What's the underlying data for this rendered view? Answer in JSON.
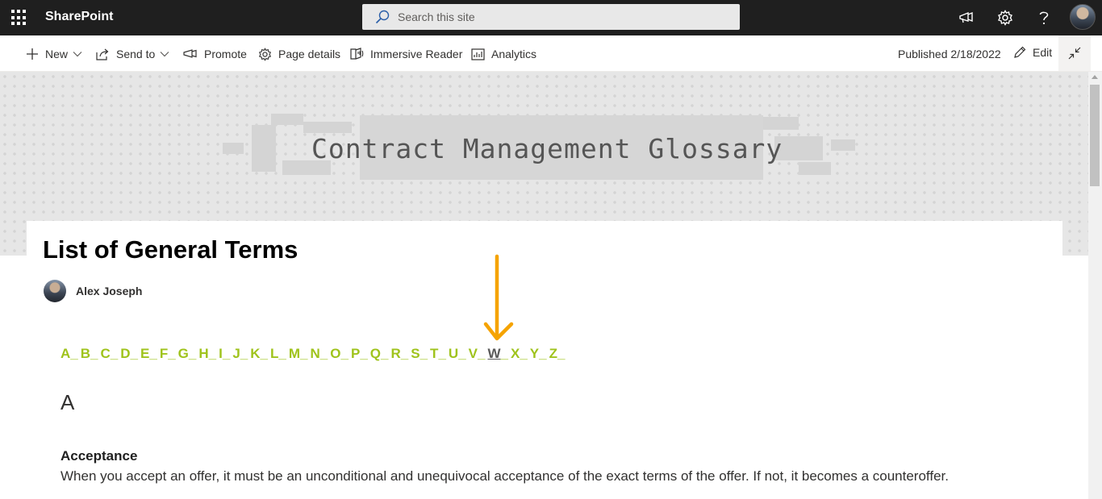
{
  "suite": {
    "app_name": "SharePoint",
    "search_placeholder": "Search this site",
    "icons": [
      "app-launcher-icon",
      "search-icon",
      "megaphone-icon",
      "gear-icon",
      "help-icon"
    ]
  },
  "commandbar": {
    "new_label": "New",
    "send_to_label": "Send to",
    "promote_label": "Promote",
    "page_details_label": "Page details",
    "immersive_reader_label": "Immersive Reader",
    "analytics_label": "Analytics",
    "published_text": "Published 2/18/2022",
    "edit_label": "Edit"
  },
  "banner": {
    "title": "Contract Management Glossary"
  },
  "page": {
    "title": "List of General Terms",
    "author": "Alex Joseph",
    "alphabet": [
      "A",
      "B",
      "C",
      "D",
      "E",
      "F",
      "G",
      "H",
      "I",
      "J",
      "K",
      "L",
      "M",
      "N",
      "O",
      "P",
      "Q",
      "R",
      "S",
      "T",
      "U",
      "V",
      "W",
      "X",
      "Y",
      "Z"
    ],
    "alphabet_separator": "_",
    "active_letter": "W",
    "section_heading": "A",
    "term": "Acceptance",
    "definition": "When you accept an offer, it must be an unconditional and unequivocal acceptance of the exact terms of the offer. If not, it becomes a counteroffer."
  },
  "colors": {
    "suitebar": "#1f1f1f",
    "alphabet_link": "#9fc31c",
    "active_letter": "#5a5a5a",
    "arrow": "#f5a300"
  }
}
